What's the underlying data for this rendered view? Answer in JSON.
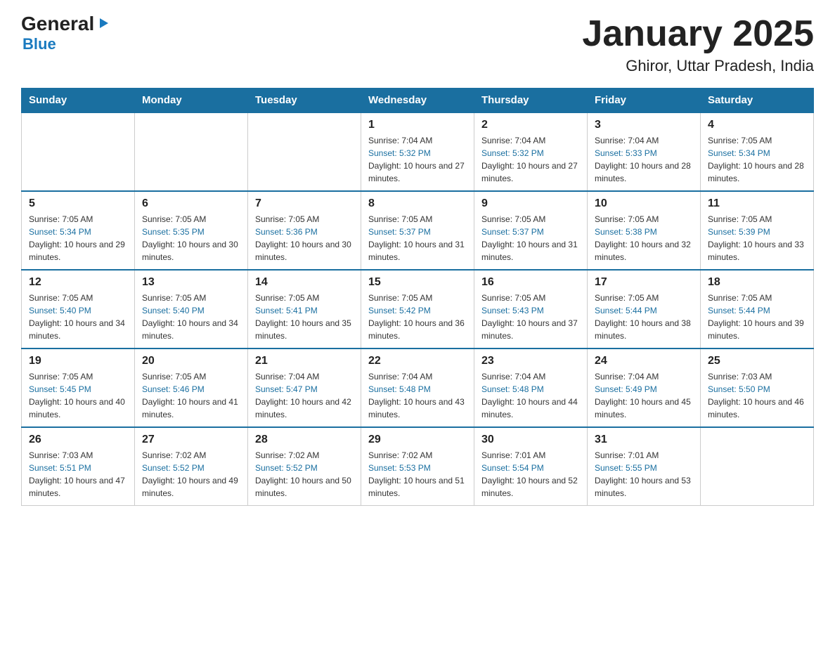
{
  "logo": {
    "general": "General",
    "blue_label": "Blue",
    "triangle": "▶"
  },
  "title": "January 2025",
  "subtitle": "Ghiror, Uttar Pradesh, India",
  "days_of_week": [
    "Sunday",
    "Monday",
    "Tuesday",
    "Wednesday",
    "Thursday",
    "Friday",
    "Saturday"
  ],
  "weeks": [
    [
      {
        "day": "",
        "info": ""
      },
      {
        "day": "",
        "info": ""
      },
      {
        "day": "",
        "info": ""
      },
      {
        "day": "1",
        "sunrise": "7:04 AM",
        "sunset": "5:32 PM",
        "daylight": "10 hours and 27 minutes."
      },
      {
        "day": "2",
        "sunrise": "7:04 AM",
        "sunset": "5:32 PM",
        "daylight": "10 hours and 27 minutes."
      },
      {
        "day": "3",
        "sunrise": "7:04 AM",
        "sunset": "5:33 PM",
        "daylight": "10 hours and 28 minutes."
      },
      {
        "day": "4",
        "sunrise": "7:05 AM",
        "sunset": "5:34 PM",
        "daylight": "10 hours and 28 minutes."
      }
    ],
    [
      {
        "day": "5",
        "sunrise": "7:05 AM",
        "sunset": "5:34 PM",
        "daylight": "10 hours and 29 minutes."
      },
      {
        "day": "6",
        "sunrise": "7:05 AM",
        "sunset": "5:35 PM",
        "daylight": "10 hours and 30 minutes."
      },
      {
        "day": "7",
        "sunrise": "7:05 AM",
        "sunset": "5:36 PM",
        "daylight": "10 hours and 30 minutes."
      },
      {
        "day": "8",
        "sunrise": "7:05 AM",
        "sunset": "5:37 PM",
        "daylight": "10 hours and 31 minutes."
      },
      {
        "day": "9",
        "sunrise": "7:05 AM",
        "sunset": "5:37 PM",
        "daylight": "10 hours and 31 minutes."
      },
      {
        "day": "10",
        "sunrise": "7:05 AM",
        "sunset": "5:38 PM",
        "daylight": "10 hours and 32 minutes."
      },
      {
        "day": "11",
        "sunrise": "7:05 AM",
        "sunset": "5:39 PM",
        "daylight": "10 hours and 33 minutes."
      }
    ],
    [
      {
        "day": "12",
        "sunrise": "7:05 AM",
        "sunset": "5:40 PM",
        "daylight": "10 hours and 34 minutes."
      },
      {
        "day": "13",
        "sunrise": "7:05 AM",
        "sunset": "5:40 PM",
        "daylight": "10 hours and 34 minutes."
      },
      {
        "day": "14",
        "sunrise": "7:05 AM",
        "sunset": "5:41 PM",
        "daylight": "10 hours and 35 minutes."
      },
      {
        "day": "15",
        "sunrise": "7:05 AM",
        "sunset": "5:42 PM",
        "daylight": "10 hours and 36 minutes."
      },
      {
        "day": "16",
        "sunrise": "7:05 AM",
        "sunset": "5:43 PM",
        "daylight": "10 hours and 37 minutes."
      },
      {
        "day": "17",
        "sunrise": "7:05 AM",
        "sunset": "5:44 PM",
        "daylight": "10 hours and 38 minutes."
      },
      {
        "day": "18",
        "sunrise": "7:05 AM",
        "sunset": "5:44 PM",
        "daylight": "10 hours and 39 minutes."
      }
    ],
    [
      {
        "day": "19",
        "sunrise": "7:05 AM",
        "sunset": "5:45 PM",
        "daylight": "10 hours and 40 minutes."
      },
      {
        "day": "20",
        "sunrise": "7:05 AM",
        "sunset": "5:46 PM",
        "daylight": "10 hours and 41 minutes."
      },
      {
        "day": "21",
        "sunrise": "7:04 AM",
        "sunset": "5:47 PM",
        "daylight": "10 hours and 42 minutes."
      },
      {
        "day": "22",
        "sunrise": "7:04 AM",
        "sunset": "5:48 PM",
        "daylight": "10 hours and 43 minutes."
      },
      {
        "day": "23",
        "sunrise": "7:04 AM",
        "sunset": "5:48 PM",
        "daylight": "10 hours and 44 minutes."
      },
      {
        "day": "24",
        "sunrise": "7:04 AM",
        "sunset": "5:49 PM",
        "daylight": "10 hours and 45 minutes."
      },
      {
        "day": "25",
        "sunrise": "7:03 AM",
        "sunset": "5:50 PM",
        "daylight": "10 hours and 46 minutes."
      }
    ],
    [
      {
        "day": "26",
        "sunrise": "7:03 AM",
        "sunset": "5:51 PM",
        "daylight": "10 hours and 47 minutes."
      },
      {
        "day": "27",
        "sunrise": "7:02 AM",
        "sunset": "5:52 PM",
        "daylight": "10 hours and 49 minutes."
      },
      {
        "day": "28",
        "sunrise": "7:02 AM",
        "sunset": "5:52 PM",
        "daylight": "10 hours and 50 minutes."
      },
      {
        "day": "29",
        "sunrise": "7:02 AM",
        "sunset": "5:53 PM",
        "daylight": "10 hours and 51 minutes."
      },
      {
        "day": "30",
        "sunrise": "7:01 AM",
        "sunset": "5:54 PM",
        "daylight": "10 hours and 52 minutes."
      },
      {
        "day": "31",
        "sunrise": "7:01 AM",
        "sunset": "5:55 PM",
        "daylight": "10 hours and 53 minutes."
      },
      {
        "day": "",
        "info": ""
      }
    ]
  ]
}
